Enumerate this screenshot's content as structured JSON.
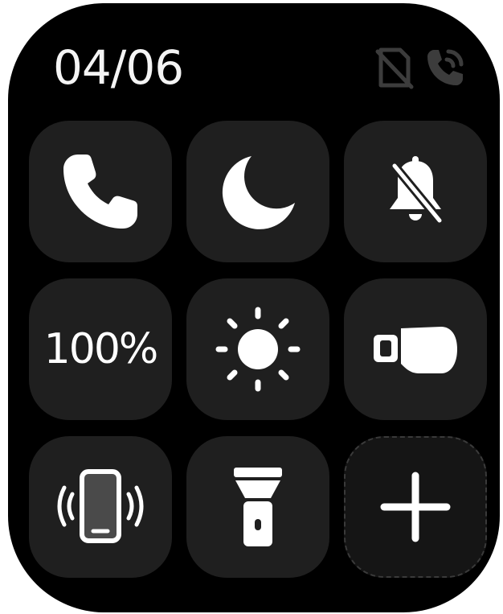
{
  "status_bar": {
    "date": "04/06",
    "icons": [
      "sim-absent-icon",
      "call-sync-icon"
    ]
  },
  "tiles": [
    {
      "icon": "phone-icon"
    },
    {
      "icon": "moon-icon"
    },
    {
      "icon": "bell-off-icon"
    },
    {
      "label": "100%"
    },
    {
      "icon": "sun-icon"
    },
    {
      "icon": "wrist-raise-icon"
    },
    {
      "icon": "find-phone-icon"
    },
    {
      "icon": "flashlight-icon"
    },
    {
      "icon": "plus-icon"
    }
  ],
  "colors": {
    "background": "#000000",
    "tile": "#1f1f1f",
    "icon": "#ffffff",
    "status_icon": "#3c3c3c"
  }
}
